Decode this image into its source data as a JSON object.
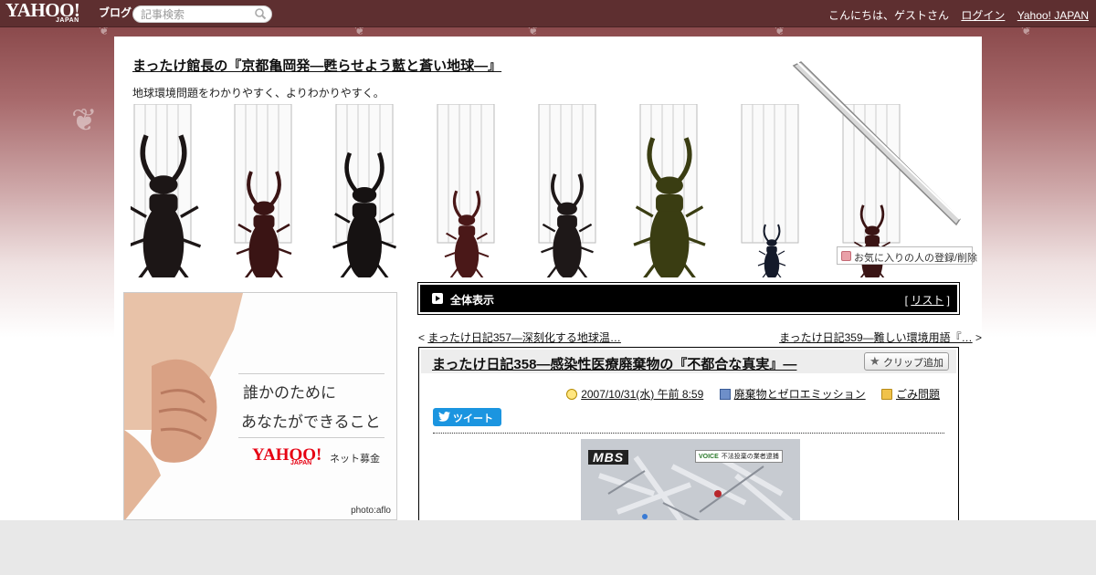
{
  "header": {
    "logo_main": "YAHOO!",
    "logo_sub": "JAPAN",
    "logo_blog": "ブログ",
    "search_placeholder": "記事検索",
    "greeting": "こんにちは、ゲストさん",
    "login": "ログイン",
    "yahoo_link": "Yahoo! JAPAN"
  },
  "blog": {
    "title": "まったけ館長の『京都亀岡発―甦らせよう藍と蒼い地球―』",
    "description": "地球環境問題をわかりやすく、よりわかりやすく。",
    "favorite_button": "お気に入りの人の登録/削除"
  },
  "ad": {
    "line1": "誰かのために",
    "line2": "あなたができること",
    "logo": "YAHOO!",
    "logo_sub": "JAPAN",
    "service": "ネット募金",
    "credit": "photo:aflo"
  },
  "nav": {
    "all_label": "全体表示",
    "list_open": "[ ",
    "list_link": "リスト",
    "list_close": " ]",
    "prev_arrow": "< ",
    "prev_title": "まったけ日記357―深刻化する地球温…",
    "next_title": "まったけ日記359―難しい環境用語『…",
    "next_arrow": "  >"
  },
  "article": {
    "title": "まったけ日記358―感染性医療廃棄物の『不都合な真実』―",
    "clip_button": "クリップ追加",
    "date": "2007/10/31(水) 午前 8:59",
    "category": "廃棄物とゼロエミッション",
    "folder": "ごみ問題",
    "tweet_button": "ツイート",
    "image_logo": "MBS",
    "image_caption_tag": "VOICE",
    "image_caption": "不法投棄の業者逮捕"
  }
}
